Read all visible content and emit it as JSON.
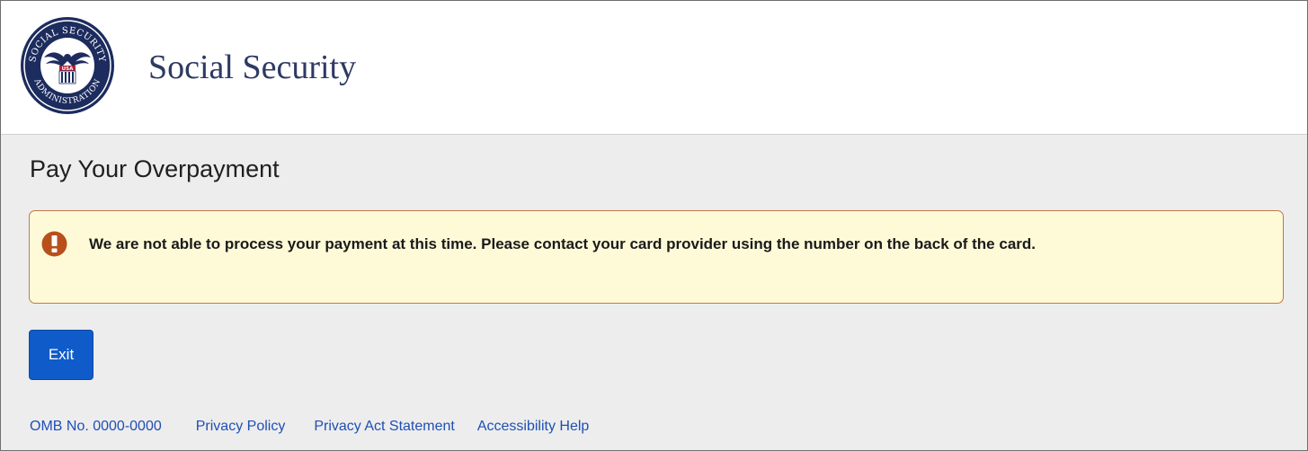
{
  "header": {
    "seal_text_top": "SOCIAL SECURITY",
    "seal_text_bottom": "ADMINISTRATION",
    "seal_text_center": "USA",
    "site_title": "Social Security"
  },
  "page": {
    "title": "Pay Your Overpayment"
  },
  "alert": {
    "icon": "exclamation-icon",
    "color": "#b8501c",
    "message": "We are not able to process your payment at this time. Please contact your card provider using the number on the back of the card."
  },
  "actions": {
    "exit_label": "Exit"
  },
  "footer": {
    "omb": "OMB No. 0000-0000",
    "privacy_policy": "Privacy Policy",
    "privacy_act": "Privacy Act Statement",
    "accessibility": "Accessibility Help"
  },
  "colors": {
    "brand_navy": "#2d3a63",
    "button_blue": "#0f5bc9",
    "alert_bg": "#fefad8",
    "alert_border": "#bf7a48",
    "link": "#1f4fb3"
  }
}
